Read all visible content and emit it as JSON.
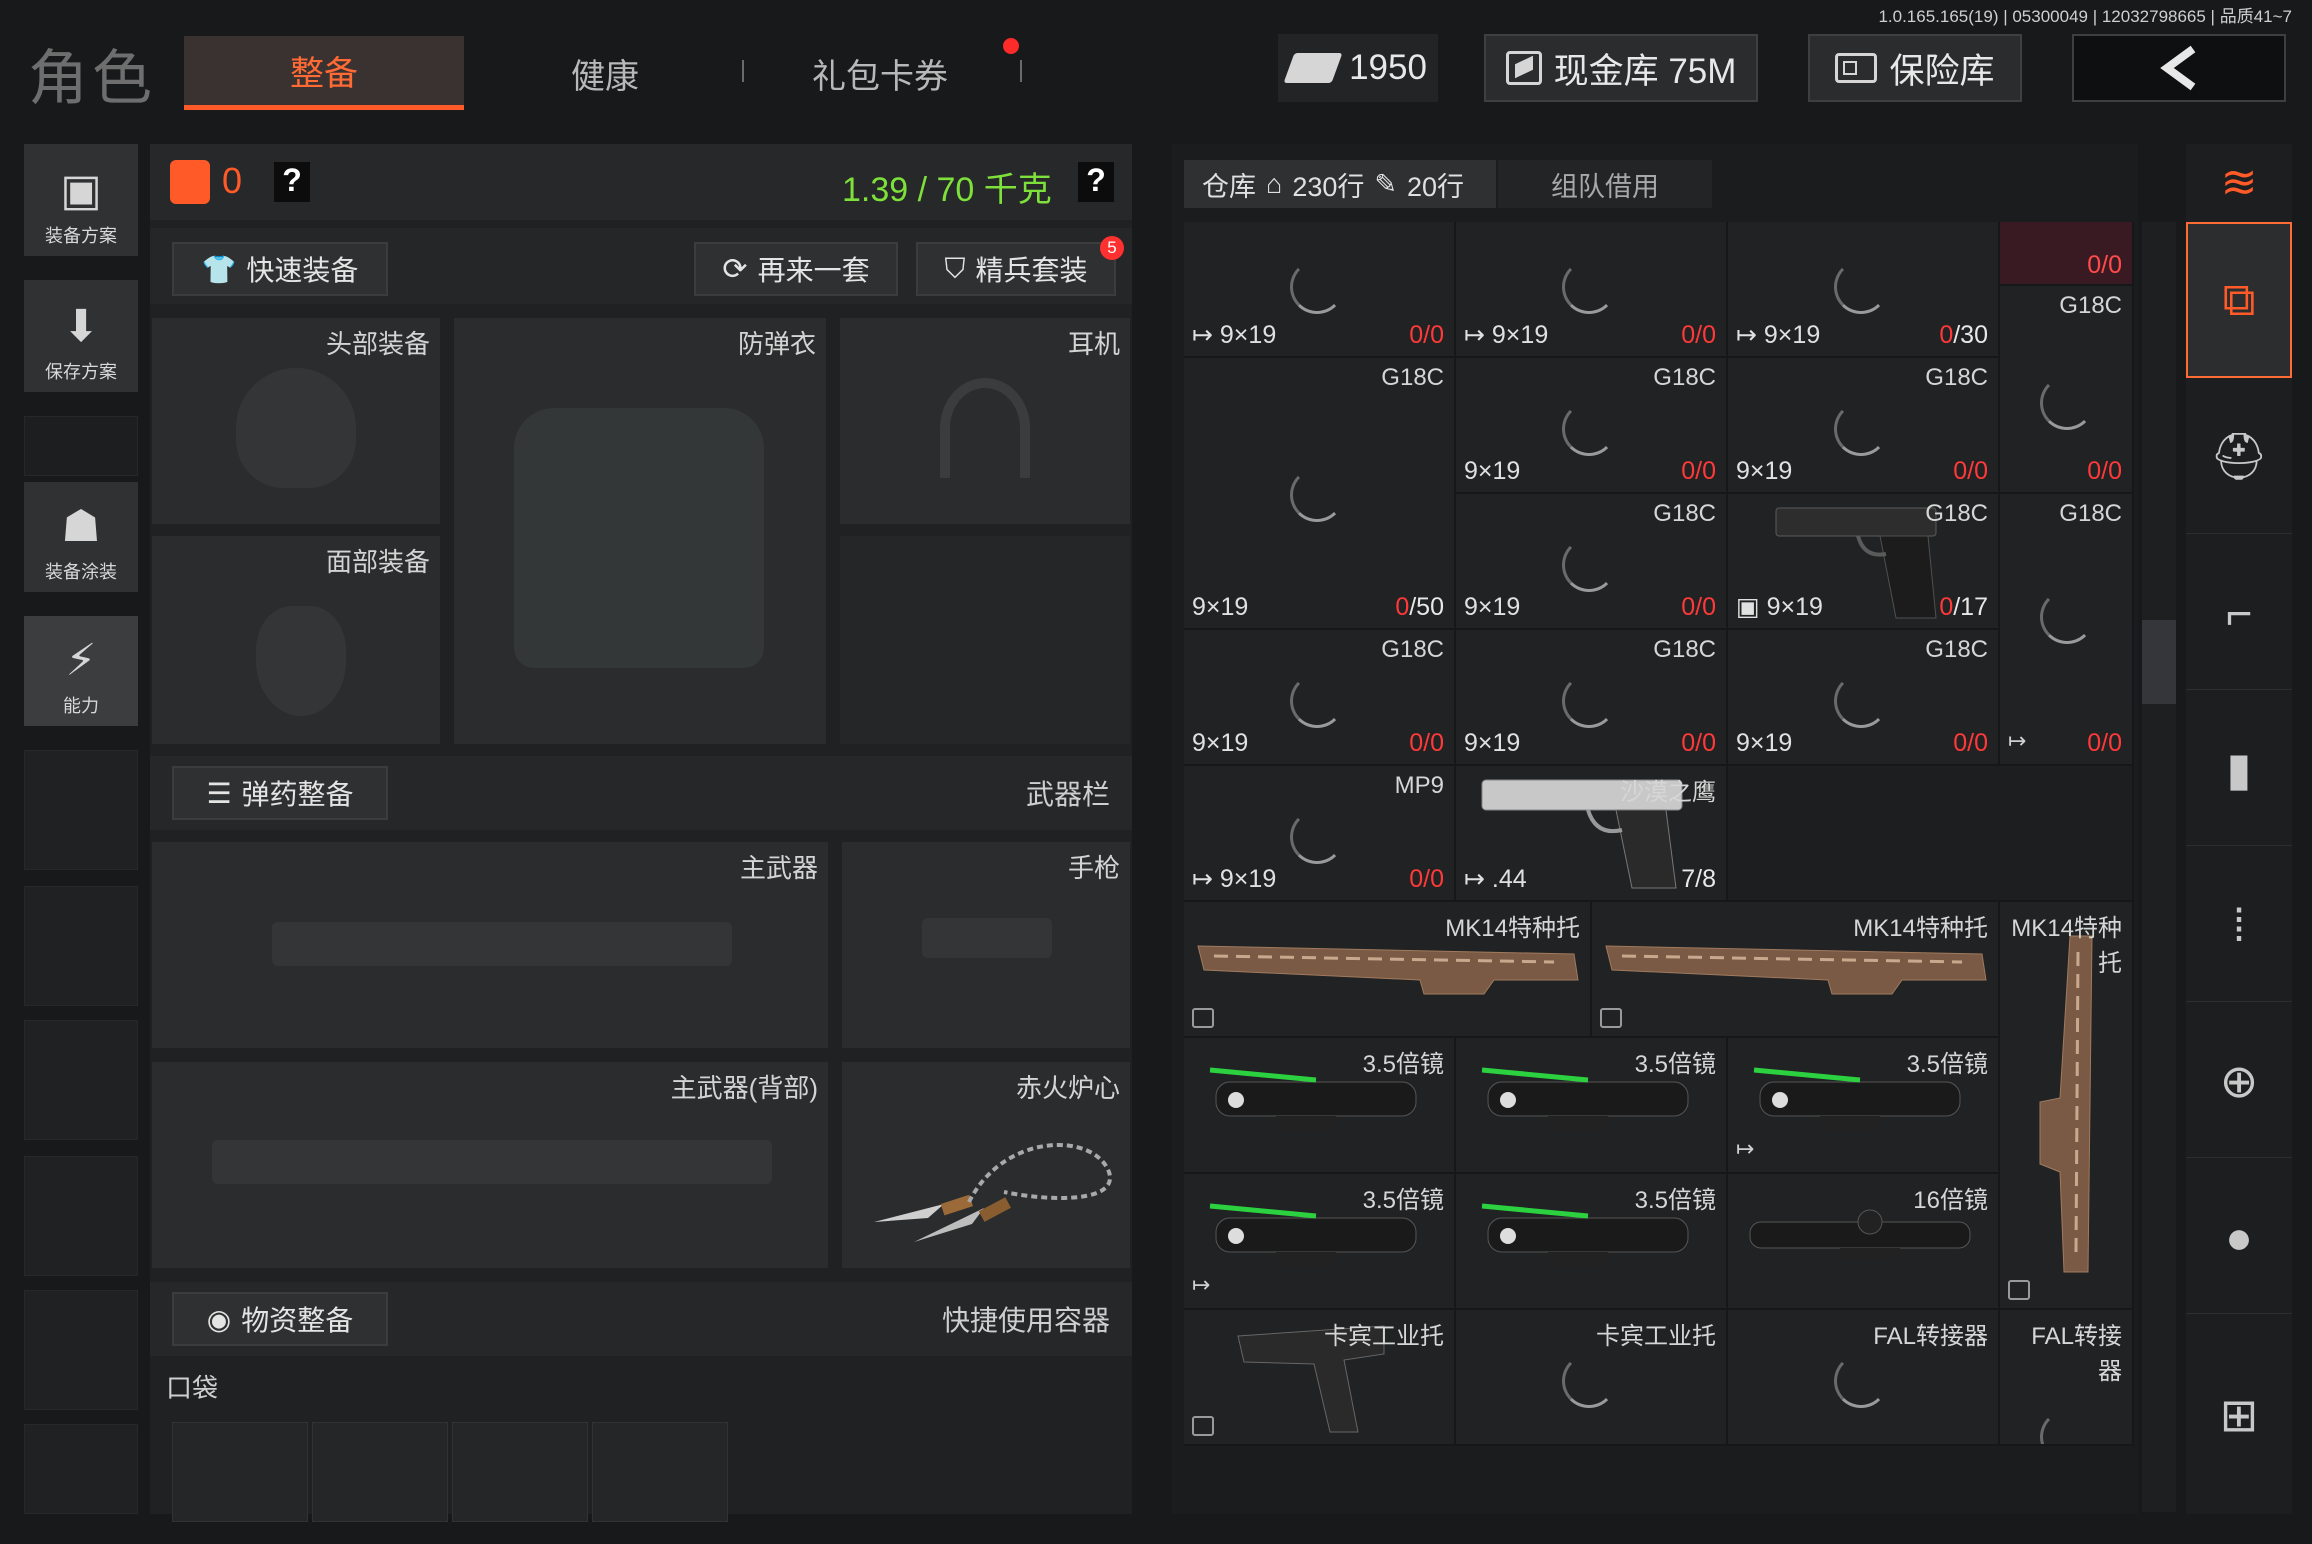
{
  "version": "1.0.165.165(19) | 05300049 | 12032798665 | 品质41~7",
  "title": "角色",
  "tabs": [
    "整备",
    "健康",
    "礼包卡券"
  ],
  "top": {
    "money": "1950",
    "cash_label": "现金库 75M",
    "safe_label": "保险库"
  },
  "left_nav": [
    {
      "label": "装备方案",
      "icon": "vest-icon"
    },
    {
      "label": "保存方案",
      "icon": "download-icon"
    },
    {
      "label": "装备涂装",
      "icon": "helmet-paint-icon"
    },
    {
      "label": "能力",
      "icon": "ability-icon"
    }
  ],
  "loadout": {
    "armor_count": "0",
    "weight": "1.39 / 70 千克",
    "help": "?",
    "quick_equip": "快速装备",
    "again": "再来一套",
    "elite": "精兵套装",
    "elite_badge": "5",
    "slots": {
      "head": "头部装备",
      "vest": "防弹衣",
      "ear": "耳机",
      "face": "面部装备",
      "primary": "主武器",
      "pistol": "手枪",
      "primary_back": "主武器(背部)",
      "melee": "赤火炉心"
    },
    "ammo_section": "弹药整备",
    "weapon_bar": "武器栏",
    "supply_section": "物资整备",
    "quick_container": "快捷使用容器",
    "pocket": "口袋"
  },
  "storage": {
    "tab_main": "仓库",
    "rows_home": "230行",
    "rows_extra": "20行",
    "tab_team": "组队借用",
    "cells": [
      {
        "cal": "9×19",
        "cnt_a": "0",
        "cnt_b": "/0",
        "spin": true
      },
      {
        "cal": "9×19",
        "cnt_a": "0",
        "cnt_b": "/0",
        "spin": true
      },
      {
        "cal": "9×19",
        "cnt_a": "0",
        "cnt_b": "/30",
        "spin": true
      },
      {
        "name": "G18C",
        "top_cnt": "0/0",
        "spin": true
      },
      {
        "name": "G18C",
        "cal": "9×19",
        "cnt_a": "0",
        "cnt_b": "/50",
        "spin": true
      },
      {
        "name": "G18C",
        "cal": "9×19",
        "cnt_a": "0",
        "cnt_b": "/0",
        "spin": true
      },
      {
        "name": "G18C",
        "cal": "9×19",
        "cnt_a": "0",
        "cnt_b": "/0",
        "spin": true
      },
      {
        "cnt_a": "0",
        "cnt_b": "/0"
      },
      {
        "name": "G18C",
        "cal": "9×19",
        "cnt_a": "0",
        "cnt_b": "/0",
        "spin": true
      },
      {
        "name": "G18C",
        "cal": "9×19",
        "cnt_a": "0",
        "cnt_b": "/17",
        "gun": true
      },
      {
        "name": "G18C",
        "spin": true
      },
      {
        "name": "G18C",
        "cal": "9×19",
        "cnt_a": "0",
        "cnt_b": "/0",
        "spin": true
      },
      {
        "name": "G18C",
        "cal": "9×19",
        "cnt_a": "0",
        "cnt_b": "/0",
        "spin": true
      },
      {
        "name": "G18C",
        "cal": "9×19",
        "cnt_a": "0",
        "cnt_b": "/0",
        "spin": true
      },
      {
        "cnt_a": "0",
        "cnt_b": "/0"
      },
      {
        "name": "MP9",
        "cal": "9×19",
        "cnt_a": "0",
        "cnt_b": "/0",
        "spin": true
      },
      {
        "name": "沙漠之鹰",
        "cal": ".44",
        "cnt_a": "7",
        "cnt_b": "/8"
      },
      {
        "name": "MK14特种托"
      },
      {
        "name": "MK14特种托"
      },
      {
        "name": "MK14特种托"
      },
      {
        "name": "3.5倍镜"
      },
      {
        "name": "3.5倍镜"
      },
      {
        "name": "3.5倍镜"
      },
      {
        "name": "3.5倍镜"
      },
      {
        "name": "3.5倍镜"
      },
      {
        "name": "16倍镜"
      },
      {
        "name": "卡宾工业托"
      },
      {
        "name": "卡宾工业托"
      },
      {
        "name": "FAL转接器"
      },
      {
        "name": "FAL转接器"
      }
    ]
  },
  "categories": [
    "refresh-stack-icon",
    "all-items-icon",
    "helmet-icon",
    "rifle-icon",
    "magazine-icon",
    "bullet-icon",
    "scope-icon",
    "grenade-icon",
    "supplies-icon"
  ],
  "colors": {
    "accent": "#ff5a28",
    "weight_ok": "#7ee03a",
    "count_zero": "#ff3838"
  }
}
